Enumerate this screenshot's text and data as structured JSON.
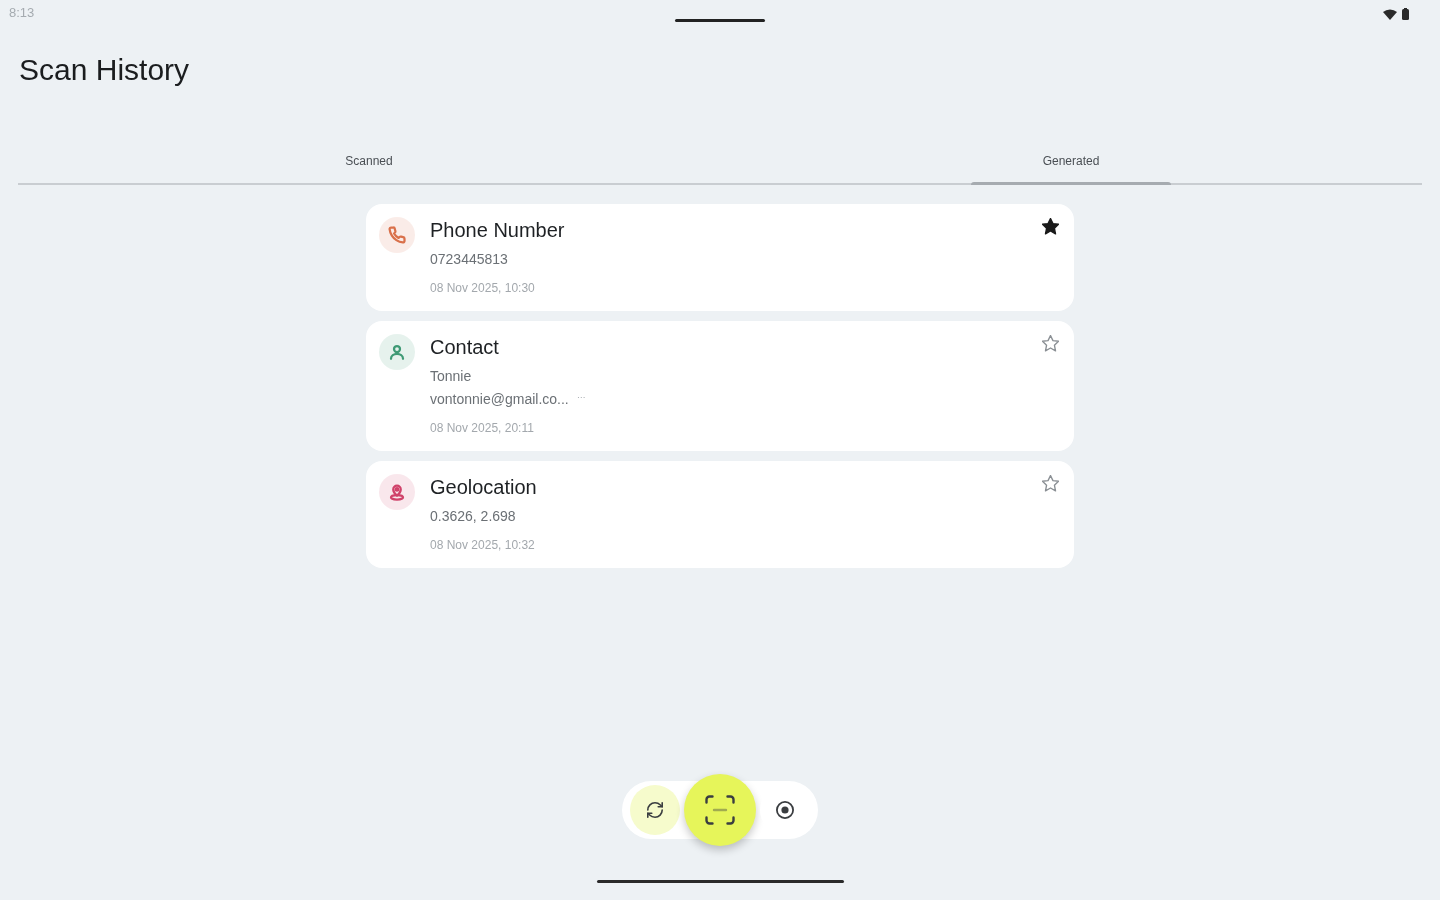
{
  "status_bar": {
    "time": "8:13"
  },
  "title": "Scan History",
  "tabs": [
    {
      "label": "Scanned",
      "selected": false
    },
    {
      "label": "Generated",
      "selected": true
    }
  ],
  "items": [
    {
      "kind": "phone",
      "color": "#d9704a",
      "title": "Phone Number",
      "lines": [
        "0723445813"
      ],
      "date": "08 Nov 2025, 10:30",
      "starred": true
    },
    {
      "kind": "contact",
      "color": "#3f9a75",
      "title": "Contact",
      "lines": [
        "Tonnie",
        "vontonnie@gmail.co..."
      ],
      "note": "…",
      "date": "08 Nov 2025, 20:11",
      "starred": false
    },
    {
      "kind": "location",
      "color": "#d0426a",
      "title": "Geolocation",
      "lines": [
        "0.3626, 2.698"
      ],
      "date": "08 Nov 2025, 10:32",
      "starred": false
    }
  ],
  "bottom_nav": [
    {
      "kind": "history",
      "selected": true
    },
    {
      "kind": "scan",
      "selected": false
    },
    {
      "kind": "generate",
      "selected": false
    }
  ]
}
